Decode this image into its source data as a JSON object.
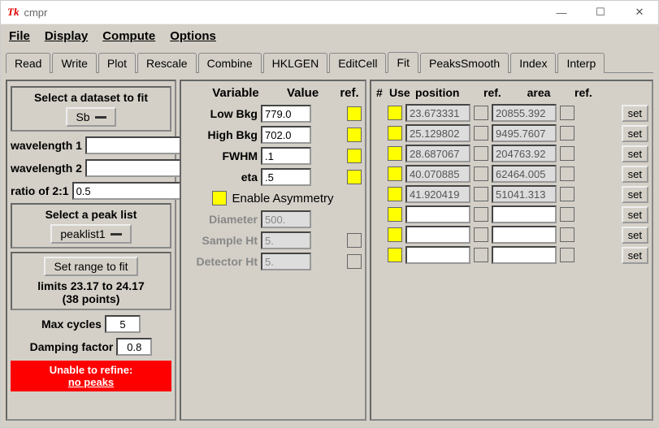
{
  "window": {
    "title": "cmpr"
  },
  "menu": {
    "file": "File",
    "display": "Display",
    "compute": "Compute",
    "options": "Options"
  },
  "tabs": [
    "Read",
    "Write",
    "Plot",
    "Rescale",
    "Combine",
    "HKLGEN",
    "EditCell",
    "Fit",
    "PeaksSmooth",
    "Index",
    "Interp"
  ],
  "active_tab": "Fit",
  "left": {
    "select_dataset": "Select a dataset to fit",
    "dataset": "Sb",
    "wavelength1_label": "wavelength 1",
    "wavelength1": "",
    "wavelength2_label": "wavelength 2",
    "wavelength2": "",
    "ratio_label": "ratio of 2:1",
    "ratio": "0.5",
    "select_peaklist": "Select a peak list",
    "peaklist": "peaklist1",
    "set_range": "Set range to fit",
    "limits": "limits 23.17 to 24.17",
    "points": "(38 points)",
    "max_cycles_label": "Max cycles",
    "max_cycles": "5",
    "damping_label": "Damping factor",
    "damping": "0.8",
    "error1": "Unable to refine:",
    "error2": "no peaks"
  },
  "mid": {
    "head_variable": "Variable",
    "head_value": "Value",
    "head_ref": "ref.",
    "low_bkg_label": "Low Bkg",
    "low_bkg": "779.0",
    "high_bkg_label": "High Bkg",
    "high_bkg": "702.0",
    "fwhm_label": "FWHM",
    "fwhm": ".1",
    "eta_label": "eta",
    "eta": ".5",
    "enable_asym": "Enable Asymmetry",
    "diameter_label": "Diameter",
    "diameter": "500.",
    "sample_ht_label": "Sample Ht",
    "sample_ht": "5.",
    "detector_ht_label": "Detector Ht",
    "detector_ht": "5."
  },
  "right": {
    "head_hash": "#",
    "head_use": "Use",
    "head_position": "position",
    "head_ref": "ref.",
    "head_area": "area",
    "head_ref2": "ref.",
    "set_label": "set",
    "rows": [
      {
        "position": "23.673331",
        "area": "20855.392"
      },
      {
        "position": "25.129802",
        "area": "9495.7607"
      },
      {
        "position": "28.687067",
        "area": "204763.92"
      },
      {
        "position": "40.070885",
        "area": "62464.005"
      },
      {
        "position": "41.920419",
        "area": "51041.313"
      },
      {
        "position": "",
        "area": ""
      },
      {
        "position": "",
        "area": ""
      },
      {
        "position": "",
        "area": ""
      }
    ]
  }
}
